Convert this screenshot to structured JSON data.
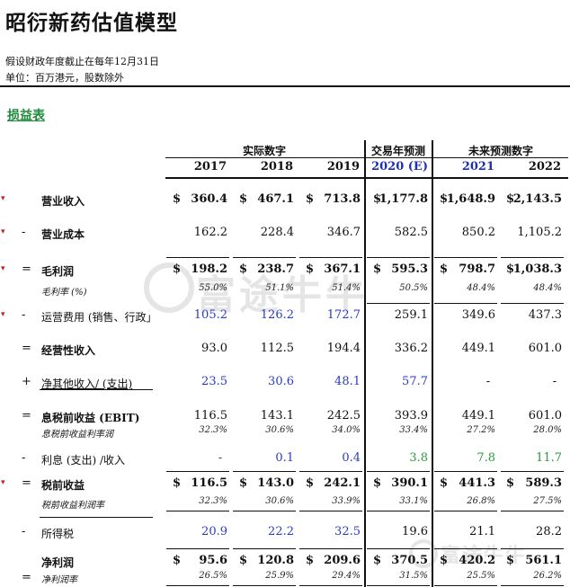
{
  "title": "昭衍新药估值模型",
  "notes": [
    "假设财政年度截止在每年12月31日",
    "单位：百万港元，股数除外"
  ],
  "section_title": "损益表",
  "groups": {
    "actual": "实际数字",
    "trading": "交易年预测",
    "future": "未来预测数字"
  },
  "years": [
    "2017",
    "2018",
    "2019",
    "2020 (E)",
    "2021",
    "2022"
  ],
  "watermark": "富途牛牛",
  "rows": [
    {
      "marker": "▾",
      "op": "",
      "label": "营业收入",
      "dollar": true,
      "values": [
        "360.4",
        "467.1",
        "713.8",
        "1,177.8",
        "1,648.9",
        "2,143.5"
      ]
    },
    {
      "marker": "▾",
      "op": "-",
      "label": "营业成本",
      "dollar": false,
      "values": [
        "162.2",
        "228.4",
        "346.7",
        "582.5",
        "850.2",
        "1,105.2"
      ]
    },
    {
      "marker": "▾",
      "op": "=",
      "label": "毛利润",
      "dollar": true,
      "values": [
        "198.2",
        "238.7",
        "367.1",
        "595.3",
        "798.7",
        "1,038.3"
      ]
    },
    {
      "marker": "",
      "op": "",
      "label": "毛利率 (%)",
      "dollar": false,
      "values": [
        "55.0%",
        "51.1%",
        "51.4%",
        "50.5%",
        "48.4%",
        "48.4%"
      ]
    },
    {
      "marker": "▾",
      "op": "-",
      "label": "运营费用 (销售、行政」",
      "dollar": false,
      "values": [
        "105.2",
        "126.2",
        "172.7",
        "259.1",
        "349.6",
        "437.3"
      ]
    },
    {
      "marker": "",
      "op": "=",
      "label": "经营性收入",
      "dollar": false,
      "values": [
        "93.0",
        "112.5",
        "194.4",
        "336.2",
        "449.1",
        "601.0"
      ]
    },
    {
      "marker": "",
      "op": "+",
      "label": "净其他收入/ (支出)",
      "dollar": false,
      "values": [
        "23.5",
        "30.6",
        "48.1",
        "57.7",
        "-",
        "-"
      ]
    },
    {
      "marker": "",
      "op": "=",
      "label": "息税前收益 (EBIT)",
      "dollar": false,
      "values": [
        "116.5",
        "143.1",
        "242.5",
        "393.9",
        "449.1",
        "601.0"
      ]
    },
    {
      "marker": "",
      "op": "",
      "label": "息税前收益利率润",
      "dollar": false,
      "values": [
        "32.3%",
        "30.6%",
        "34.0%",
        "33.4%",
        "27.2%",
        "28.0%"
      ]
    },
    {
      "marker": "",
      "op": "-",
      "label": "利息 (支出) /收入",
      "dollar": false,
      "values": [
        "-",
        "0.1",
        "0.4",
        "3.8",
        "7.8",
        "11.7"
      ]
    },
    {
      "marker": "▾",
      "op": "=",
      "label": "税前收益",
      "dollar": true,
      "values": [
        "116.5",
        "143.0",
        "242.1",
        "390.1",
        "441.3",
        "589.3"
      ]
    },
    {
      "marker": "",
      "op": "",
      "label": "税前收益利润率",
      "dollar": false,
      "values": [
        "32.3%",
        "30.6%",
        "33.9%",
        "33.1%",
        "26.8%",
        "27.5%"
      ]
    },
    {
      "marker": "",
      "op": "-",
      "label": "所得税",
      "dollar": false,
      "values": [
        "20.9",
        "22.2",
        "32.5",
        "19.6",
        "21.1",
        "28.2"
      ]
    },
    {
      "marker": "",
      "op": "",
      "label": "净利润",
      "dollar": true,
      "values": [
        "95.6",
        "120.8",
        "209.6",
        "370.5",
        "420.2",
        "561.1"
      ]
    },
    {
      "marker": "",
      "op": "=",
      "label": "净利润率",
      "dollar": false,
      "values": [
        "26.5%",
        "25.9%",
        "29.4%",
        "31.5%",
        "25.5%",
        "26.2%"
      ]
    }
  ],
  "colors": {
    "section_green": "#1f8a3a",
    "year_blue": "#1f2fb5",
    "input_blue": "#2b3bc4",
    "formula_green": "#2a9a3a",
    "marker_red": "#c02020"
  }
}
